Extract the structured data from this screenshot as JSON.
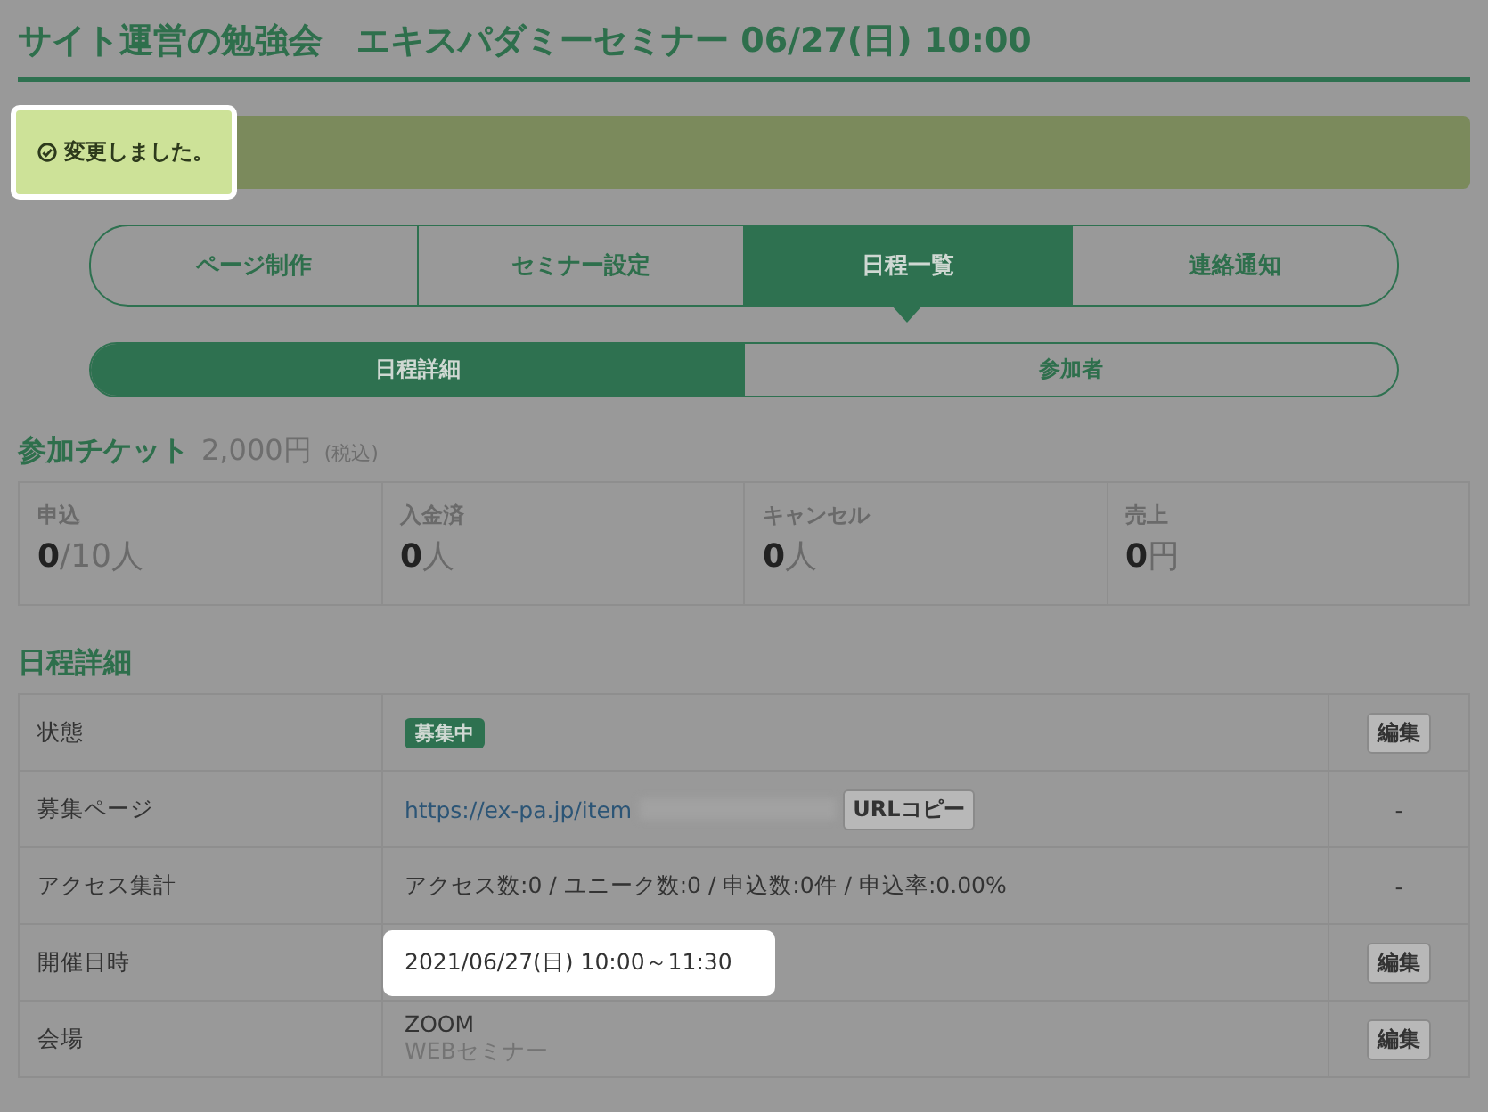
{
  "page_title": "サイト運営の勉強会　エキスパダミーセミナー 06/27(日) 10:00",
  "message": {
    "text": "変更しました。",
    "highlighted": true
  },
  "tabs": [
    {
      "label": "ページ制作",
      "selected": false
    },
    {
      "label": "セミナー設定",
      "selected": false
    },
    {
      "label": "日程一覧",
      "selected": true
    },
    {
      "label": "連絡通知",
      "selected": false
    }
  ],
  "subtabs": [
    {
      "label": "日程詳細",
      "selected": true
    },
    {
      "label": "参加者",
      "selected": false
    }
  ],
  "ticket": {
    "title": "参加チケット",
    "price": "2,000円",
    "tax_note": "(税込)"
  },
  "stats": [
    {
      "label": "申込",
      "value": "0",
      "unit": "/10人"
    },
    {
      "label": "入金済",
      "value": "0",
      "unit": "人"
    },
    {
      "label": "キャンセル",
      "value": "0",
      "unit": "人"
    },
    {
      "label": "売上",
      "value": "0",
      "unit": "円"
    }
  ],
  "details": {
    "title": "日程詳細",
    "rows": [
      {
        "label": "状態",
        "kind": "badge",
        "value": "募集中",
        "action": "編集",
        "highlighted": false
      },
      {
        "label": "募集ページ",
        "kind": "link",
        "value": "https://ex-pa.jp/item",
        "button": "URLコピー",
        "action": "-",
        "highlighted": false
      },
      {
        "label": "アクセス集計",
        "kind": "text",
        "value": "アクセス数:0 / ユニーク数:0 / 申込数:0件 / 申込率:0.00%",
        "action": "-",
        "highlighted": false
      },
      {
        "label": "開催日時",
        "kind": "text",
        "value": "2021/06/27(日) 10:00～11:30",
        "action": "編集",
        "highlighted": true
      },
      {
        "label": "会場",
        "kind": "text",
        "value": "ZOOM",
        "sub": "WEBセミナー",
        "action": "編集",
        "highlighted": false
      }
    ]
  }
}
